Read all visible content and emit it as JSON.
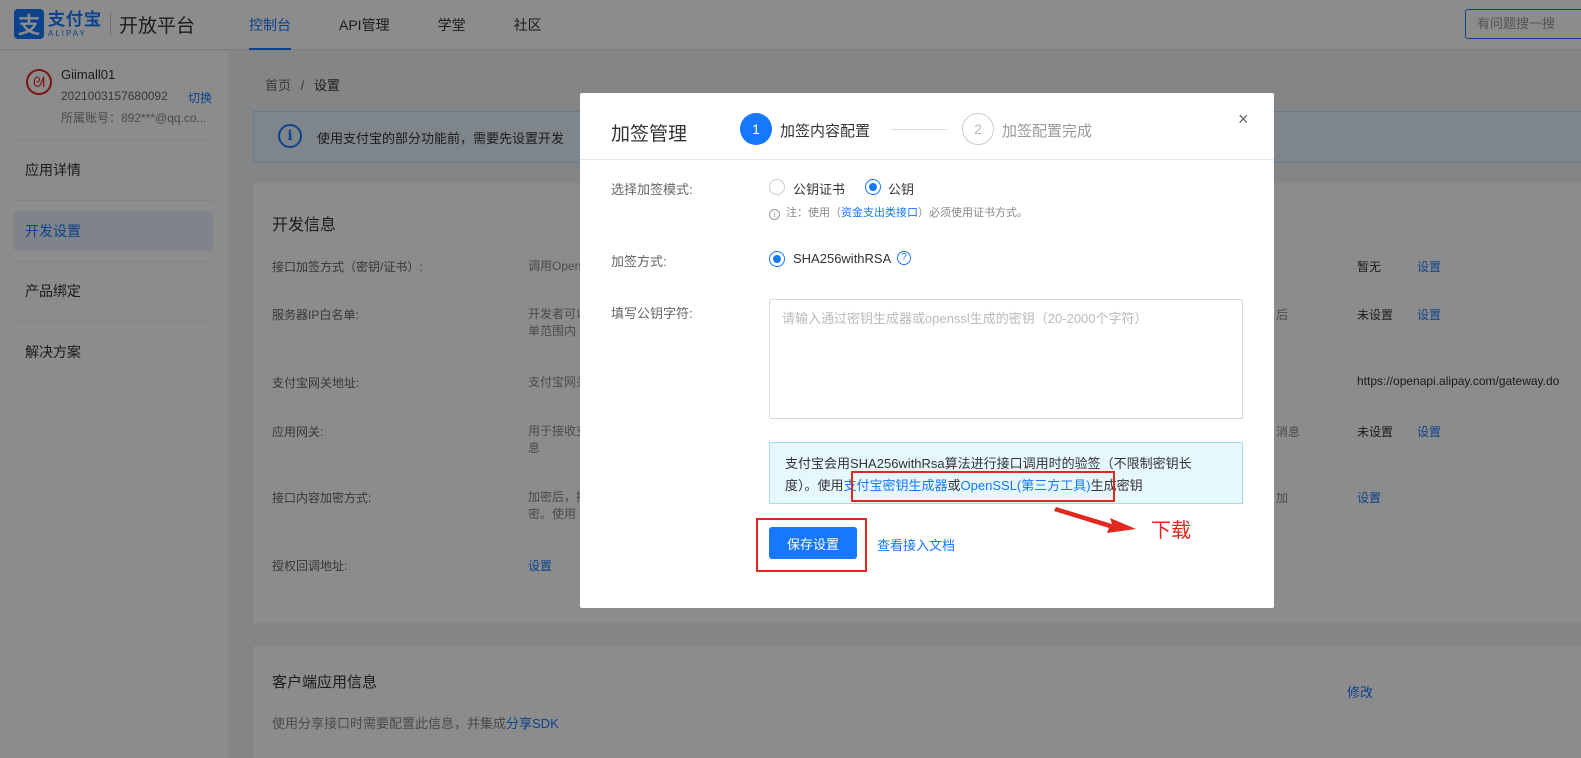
{
  "header": {
    "logo_cn": "支付宝",
    "logo_en": "ALIPAY",
    "platform": "开放平台",
    "nav": [
      {
        "label": "控制台",
        "active": true
      },
      {
        "label": "API管理"
      },
      {
        "label": "学堂"
      },
      {
        "label": "社区"
      }
    ],
    "search_placeholder": "有问题搜一搜"
  },
  "sidebar": {
    "user_name": "Giimall01",
    "app_id": "2021003157680092",
    "switch_label": "切换",
    "account": "所属账号：892***@qq.co...",
    "items": [
      {
        "label": "应用详情"
      },
      {
        "label": "开发设置",
        "active": true
      },
      {
        "label": "产品绑定"
      },
      {
        "label": "解决方案"
      }
    ]
  },
  "main": {
    "breadcrumb": [
      "首页",
      "/",
      "设置"
    ],
    "alert_text": "使用支付宝的部分功能前，需要先设置开发",
    "dev_info": {
      "title": "开发信息",
      "rows": [
        {
          "label": "接口加签方式（密钥/证书）:",
          "desc": "调用Open",
          "status": "暂无",
          "link": "设置"
        },
        {
          "label": "服务器IP白名单:",
          "desc": "开发者可以单范围内",
          "frag": "后",
          "status": "未设置",
          "link": "设置"
        },
        {
          "label": "支付宝网关地址:",
          "desc": "支付宝网关",
          "value": "https://openapi.alipay.com/gateway.do"
        },
        {
          "label": "应用网关:",
          "desc": "用于接收支息",
          "frag": "消息",
          "status": "未设置",
          "link": "设置"
        },
        {
          "label": "接口内容加密方式:",
          "desc": "加密后，接密。使用",
          "frag": "加",
          "link": "设置"
        },
        {
          "label": "授权回调地址:",
          "link": "设置"
        }
      ]
    },
    "client_info": {
      "title": "客户端应用信息",
      "edit": "修改",
      "desc_prefix": "使用分享接口时需要配置此信息，并集成",
      "desc_link": "分享SDK"
    }
  },
  "modal": {
    "title": "加签管理",
    "steps": [
      {
        "num": "1",
        "label": "加签内容配置",
        "active": true
      },
      {
        "num": "2",
        "label": "加签配置完成",
        "active": false
      }
    ],
    "close": "×",
    "mode_label": "选择加签模式:",
    "mode_options": [
      {
        "label": "公钥证书",
        "checked": false
      },
      {
        "label": "公钥",
        "checked": true
      }
    ],
    "note_prefix": "注：使用（",
    "note_link": "资金支出类接口",
    "note_suffix": "）必须使用证书方式。",
    "method_label": "加签方式:",
    "method_option": "SHA256withRSA",
    "help": "?",
    "key_label": "填写公钥字符:",
    "key_placeholder": "请输入通过密钥生成器或openssl生成的密钥（20-2000个字符）",
    "key_value": "",
    "info_line1": "支付宝会用SHA256withRsa算法进行接口调用时的验签（不限制密钥长",
    "info_line2_prefix": "度）。使用",
    "info_link1": "支付宝密钥生成器",
    "info_or": "或",
    "info_link2": "OpenSSL(第三方工具)",
    "info_suffix": "生成密钥",
    "save_button": "保存设置",
    "doc_link": "查看接入文档"
  },
  "annotation": {
    "download_label": "下载",
    "color": "#e0281e"
  },
  "colors": {
    "primary": "#1677ff",
    "overlay": "rgba(0,0,0,0.45)"
  }
}
